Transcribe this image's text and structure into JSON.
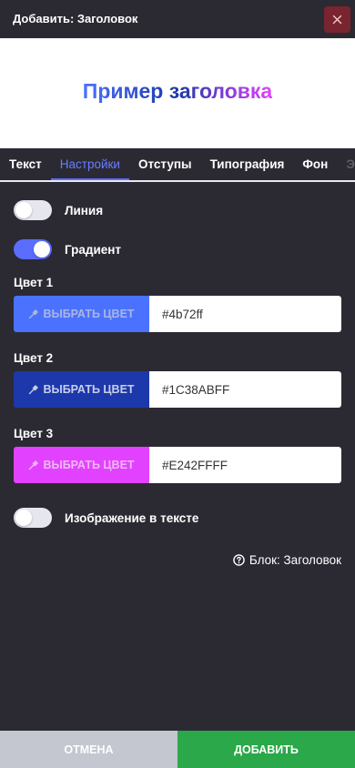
{
  "header": {
    "title": "Добавить: Заголовок"
  },
  "preview": {
    "text": "Пример заголовка"
  },
  "tabs": [
    {
      "label": "Текст"
    },
    {
      "label": "Настройки"
    },
    {
      "label": "Отступы"
    },
    {
      "label": "Типография"
    },
    {
      "label": "Фон"
    },
    {
      "label": "Э"
    }
  ],
  "settings": {
    "line": {
      "label": "Линия",
      "enabled": false
    },
    "gradient": {
      "label": "Градиент",
      "enabled": true
    },
    "image_in_text": {
      "label": "Изображение в тексте",
      "enabled": false
    }
  },
  "colors": [
    {
      "label": "Цвет 1",
      "button_label": "ВЫБРАТЬ ЦВЕТ",
      "value": "#4b72ff",
      "swatch": "#4b72ff",
      "text_color": "#aab6e0"
    },
    {
      "label": "Цвет 2",
      "button_label": "ВЫБРАТЬ ЦВЕТ",
      "value": "#1C38ABFF",
      "swatch": "#1c38ab",
      "text_color": "#c9cdea"
    },
    {
      "label": "Цвет 3",
      "button_label": "ВЫБРАТЬ ЦВЕТ",
      "value": "#E242FFFF",
      "swatch": "#e242ff",
      "text_color": "#f0b8f8"
    }
  ],
  "block_link": {
    "label": "Блок: Заголовок"
  },
  "footer": {
    "cancel": "ОТМЕНА",
    "add": "ДОБАВИТЬ"
  }
}
